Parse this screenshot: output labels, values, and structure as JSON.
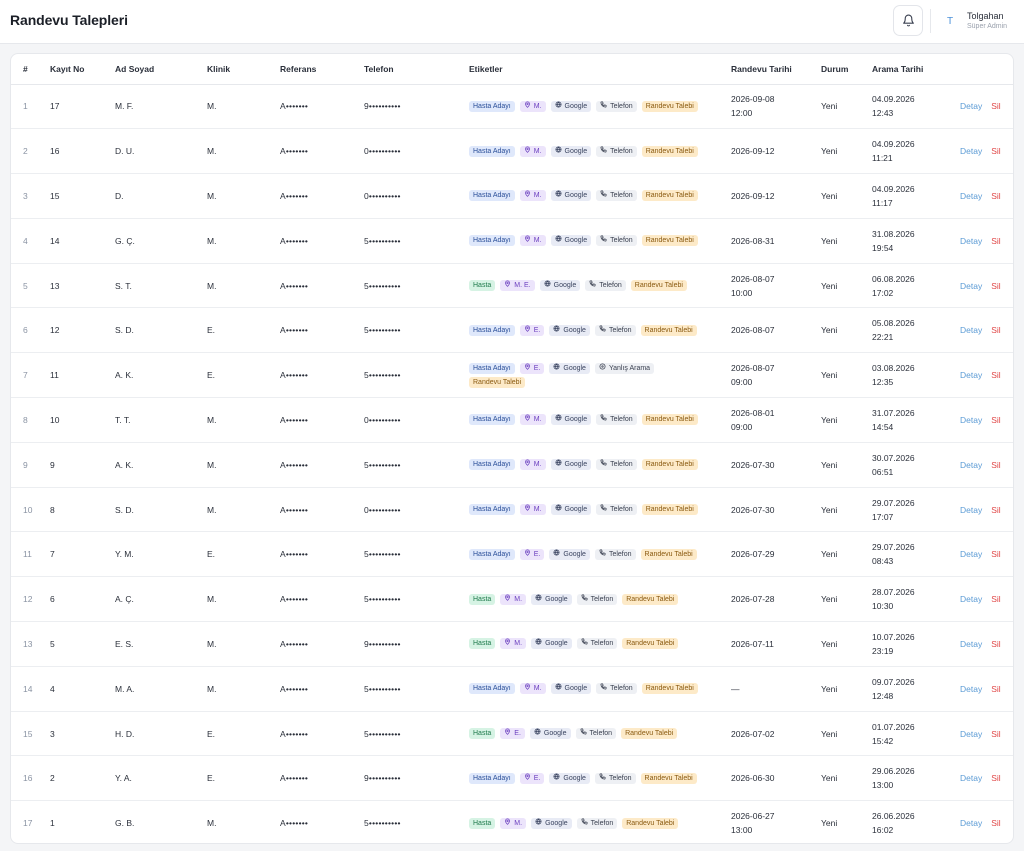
{
  "header": {
    "title": "Randevu Talepleri",
    "user_initial": "T",
    "user_name": "Tolgahan",
    "user_role": "Süper Admin"
  },
  "table": {
    "columns": [
      "#",
      "Kayıt No",
      "Ad Soyad",
      "Klinik",
      "Referans",
      "Telefon",
      "Etiketler",
      "Randevu Tarihi",
      "Durum",
      "Arama Tarihi"
    ],
    "action_labels": {
      "detail": "Detay",
      "delete": "Sil"
    },
    "rows": [
      {
        "idx": "1",
        "kayit": "17",
        "ad": "M. F.",
        "klinik": "M.",
        "ref": "A•••••••",
        "tel": "9••••••••••",
        "status_tag": "Hasta Adayı",
        "status_kind": "aday",
        "clinic_tag": "M.",
        "source_tag": "Google",
        "channel_tag": "Telefon",
        "channel_icon": "phone",
        "request_tag": "Randevu Talebi",
        "randevu_date": "2026-09-08",
        "randevu_time": "12:00",
        "durum": "Yeni",
        "arama_date": "04.09.2026",
        "arama_time": "12:43"
      },
      {
        "idx": "2",
        "kayit": "16",
        "ad": "D. U.",
        "klinik": "M.",
        "ref": "A•••••••",
        "tel": "0••••••••••",
        "status_tag": "Hasta Adayı",
        "status_kind": "aday",
        "clinic_tag": "M.",
        "source_tag": "Google",
        "channel_tag": "Telefon",
        "channel_icon": "phone",
        "request_tag": "Randevu Talebi",
        "randevu_date": "2026-09-12",
        "randevu_time": "",
        "durum": "Yeni",
        "arama_date": "04.09.2026",
        "arama_time": "11:21"
      },
      {
        "idx": "3",
        "kayit": "15",
        "ad": "D.",
        "klinik": "M.",
        "ref": "A•••••••",
        "tel": "0••••••••••",
        "status_tag": "Hasta Adayı",
        "status_kind": "aday",
        "clinic_tag": "M.",
        "source_tag": "Google",
        "channel_tag": "Telefon",
        "channel_icon": "phone",
        "request_tag": "Randevu Talebi",
        "randevu_date": "2026-09-12",
        "randevu_time": "",
        "durum": "Yeni",
        "arama_date": "04.09.2026",
        "arama_time": "11:17"
      },
      {
        "idx": "4",
        "kayit": "14",
        "ad": "G. Ç.",
        "klinik": "M.",
        "ref": "A•••••••",
        "tel": "5••••••••••",
        "status_tag": "Hasta Adayı",
        "status_kind": "aday",
        "clinic_tag": "M.",
        "source_tag": "Google",
        "channel_tag": "Telefon",
        "channel_icon": "phone",
        "request_tag": "Randevu Talebi",
        "randevu_date": "2026-08-31",
        "randevu_time": "",
        "durum": "Yeni",
        "arama_date": "31.08.2026",
        "arama_time": "19:54"
      },
      {
        "idx": "5",
        "kayit": "13",
        "ad": "S. T.",
        "klinik": "M.",
        "ref": "A•••••••",
        "tel": "5••••••••••",
        "status_tag": "Hasta",
        "status_kind": "hasta",
        "clinic_tag": "M. E.",
        "source_tag": "Google",
        "channel_tag": "Telefon",
        "channel_icon": "phone",
        "request_tag": "Randevu Talebi",
        "randevu_date": "2026-08-07",
        "randevu_time": "10:00",
        "durum": "Yeni",
        "arama_date": "06.08.2026",
        "arama_time": "17:02"
      },
      {
        "idx": "6",
        "kayit": "12",
        "ad": "S. D.",
        "klinik": "E.",
        "ref": "A•••••••",
        "tel": "5••••••••••",
        "status_tag": "Hasta Adayı",
        "status_kind": "aday",
        "clinic_tag": "E.",
        "source_tag": "Google",
        "channel_tag": "Telefon",
        "channel_icon": "phone",
        "request_tag": "Randevu Talebi",
        "randevu_date": "2026-08-07",
        "randevu_time": "",
        "durum": "Yeni",
        "arama_date": "05.08.2026",
        "arama_time": "22:21"
      },
      {
        "idx": "7",
        "kayit": "11",
        "ad": "A. K.",
        "klinik": "E.",
        "ref": "A•••••••",
        "tel": "5••••••••••",
        "status_tag": "Hasta Adayı",
        "status_kind": "aday",
        "clinic_tag": "E.",
        "source_tag": "Google",
        "channel_tag": "Yanlış Arama",
        "channel_icon": "circle",
        "request_tag": "Randevu Talebi",
        "randevu_date": "2026-08-07",
        "randevu_time": "09:00",
        "durum": "Yeni",
        "arama_date": "03.08.2026",
        "arama_time": "12:35"
      },
      {
        "idx": "8",
        "kayit": "10",
        "ad": "T. T.",
        "klinik": "M.",
        "ref": "A•••••••",
        "tel": "0••••••••••",
        "status_tag": "Hasta Adayı",
        "status_kind": "aday",
        "clinic_tag": "M.",
        "source_tag": "Google",
        "channel_tag": "Telefon",
        "channel_icon": "phone",
        "request_tag": "Randevu Talebi",
        "randevu_date": "2026-08-01",
        "randevu_time": "09:00",
        "durum": "Yeni",
        "arama_date": "31.07.2026",
        "arama_time": "14:54"
      },
      {
        "idx": "9",
        "kayit": "9",
        "ad": "A. K.",
        "klinik": "M.",
        "ref": "A•••••••",
        "tel": "5••••••••••",
        "status_tag": "Hasta Adayı",
        "status_kind": "aday",
        "clinic_tag": "M.",
        "source_tag": "Google",
        "channel_tag": "Telefon",
        "channel_icon": "phone",
        "request_tag": "Randevu Talebi",
        "randevu_date": "2026-07-30",
        "randevu_time": "",
        "durum": "Yeni",
        "arama_date": "30.07.2026",
        "arama_time": "06:51"
      },
      {
        "idx": "10",
        "kayit": "8",
        "ad": "S. D.",
        "klinik": "M.",
        "ref": "A•••••••",
        "tel": "0••••••••••",
        "status_tag": "Hasta Adayı",
        "status_kind": "aday",
        "clinic_tag": "M.",
        "source_tag": "Google",
        "channel_tag": "Telefon",
        "channel_icon": "phone",
        "request_tag": "Randevu Talebi",
        "randevu_date": "2026-07-30",
        "randevu_time": "",
        "durum": "Yeni",
        "arama_date": "29.07.2026",
        "arama_time": "17:07"
      },
      {
        "idx": "11",
        "kayit": "7",
        "ad": "Y. M.",
        "klinik": "E.",
        "ref": "A•••••••",
        "tel": "5••••••••••",
        "status_tag": "Hasta Adayı",
        "status_kind": "aday",
        "clinic_tag": "E.",
        "source_tag": "Google",
        "channel_tag": "Telefon",
        "channel_icon": "phone",
        "request_tag": "Randevu Talebi",
        "randevu_date": "2026-07-29",
        "randevu_time": "",
        "durum": "Yeni",
        "arama_date": "29.07.2026",
        "arama_time": "08:43"
      },
      {
        "idx": "12",
        "kayit": "6",
        "ad": "A. Ç.",
        "klinik": "M.",
        "ref": "A•••••••",
        "tel": "5••••••••••",
        "status_tag": "Hasta",
        "status_kind": "hasta",
        "clinic_tag": "M.",
        "source_tag": "Google",
        "channel_tag": "Telefon",
        "channel_icon": "phone",
        "request_tag": "Randevu Talebi",
        "randevu_date": "2026-07-28",
        "randevu_time": "",
        "durum": "Yeni",
        "arama_date": "28.07.2026",
        "arama_time": "10:30"
      },
      {
        "idx": "13",
        "kayit": "5",
        "ad": "E. S.",
        "klinik": "M.",
        "ref": "A•••••••",
        "tel": "9••••••••••",
        "status_tag": "Hasta",
        "status_kind": "hasta",
        "clinic_tag": "M.",
        "source_tag": "Google",
        "channel_tag": "Telefon",
        "channel_icon": "phone",
        "request_tag": "Randevu Talebi",
        "randevu_date": "2026-07-11",
        "randevu_time": "",
        "durum": "Yeni",
        "arama_date": "10.07.2026",
        "arama_time": "23:19"
      },
      {
        "idx": "14",
        "kayit": "4",
        "ad": "M. A.",
        "klinik": "M.",
        "ref": "A•••••••",
        "tel": "5••••••••••",
        "status_tag": "Hasta Adayı",
        "status_kind": "aday",
        "clinic_tag": "M.",
        "source_tag": "Google",
        "channel_tag": "Telefon",
        "channel_icon": "phone",
        "request_tag": "Randevu Talebi",
        "randevu_date": "—",
        "randevu_time": "",
        "durum": "Yeni",
        "arama_date": "09.07.2026",
        "arama_time": "12:48"
      },
      {
        "idx": "15",
        "kayit": "3",
        "ad": "H. D.",
        "klinik": "E.",
        "ref": "A•••••••",
        "tel": "5••••••••••",
        "status_tag": "Hasta",
        "status_kind": "hasta",
        "clinic_tag": "E.",
        "source_tag": "Google",
        "channel_tag": "Telefon",
        "channel_icon": "phone",
        "request_tag": "Randevu Talebi",
        "randevu_date": "2026-07-02",
        "randevu_time": "",
        "durum": "Yeni",
        "arama_date": "01.07.2026",
        "arama_time": "15:42"
      },
      {
        "idx": "16",
        "kayit": "2",
        "ad": "Y. A.",
        "klinik": "E.",
        "ref": "A•••••••",
        "tel": "9••••••••••",
        "status_tag": "Hasta Adayı",
        "status_kind": "aday",
        "clinic_tag": "E.",
        "source_tag": "Google",
        "channel_tag": "Telefon",
        "channel_icon": "phone",
        "request_tag": "Randevu Talebi",
        "randevu_date": "2026-06-30",
        "randevu_time": "",
        "durum": "Yeni",
        "arama_date": "29.06.2026",
        "arama_time": "13:00"
      },
      {
        "idx": "17",
        "kayit": "1",
        "ad": "G. B.",
        "klinik": "M.",
        "ref": "A•••••••",
        "tel": "5••••••••••",
        "status_tag": "Hasta",
        "status_kind": "hasta",
        "clinic_tag": "M.",
        "source_tag": "Google",
        "channel_tag": "Telefon",
        "channel_icon": "phone",
        "request_tag": "Randevu Talebi",
        "randevu_date": "2026-06-27",
        "randevu_time": "13:00",
        "durum": "Yeni",
        "arama_date": "26.06.2026",
        "arama_time": "16:02"
      }
    ]
  }
}
